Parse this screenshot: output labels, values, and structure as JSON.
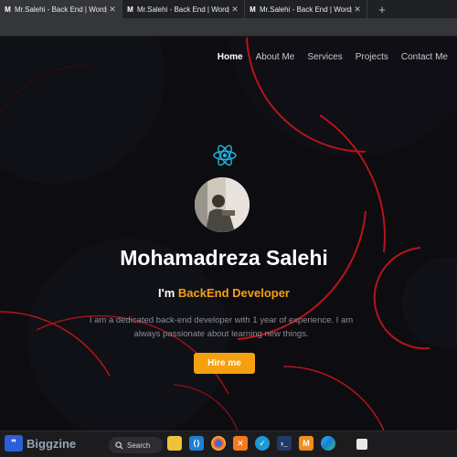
{
  "browser": {
    "tabs": [
      {
        "title": "Mr.Salehi - Back End | Wordpress",
        "close": "✕"
      },
      {
        "title": "Mr.Salehi - Back End | Wordpress",
        "close": "✕"
      },
      {
        "title": "Mr.Salehi - Back End | Wordpress",
        "close": "✕"
      }
    ],
    "new_tab": "+"
  },
  "nav": {
    "items": [
      "Home",
      "About Me",
      "Services",
      "Projects",
      "Contact Me"
    ],
    "active": "Home"
  },
  "hero": {
    "name": "Mohamadreza Salehi",
    "role_prefix": "I'm",
    "role_accent": "BackEnd Developer",
    "description": "I am a dedicated back-end developer with 1 year of experience. I am always passionate about learning new things.",
    "button": "Hire me"
  },
  "taskbar": {
    "brand": "Biggzine",
    "search_label": "Search",
    "app_icons": [
      "file-explorer-icon",
      "vscode-icon",
      "chrome-icon",
      "xampp-icon",
      "git-icon",
      "terminal-icon",
      "app-icon",
      "edge-icon",
      "snip-icon"
    ]
  },
  "colors": {
    "accent": "#f5a10f",
    "background": "#0c0c11",
    "arc": "#c0161a",
    "react": "#1fb6e0"
  }
}
